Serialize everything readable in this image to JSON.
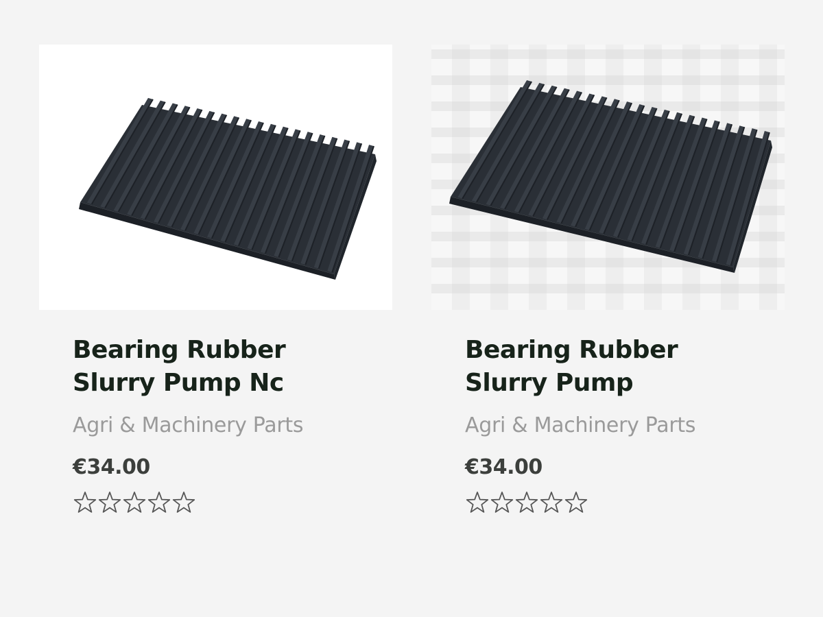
{
  "products": [
    {
      "image_alt": "Bearing Rubber Slurry Pump Nc",
      "title": "Bearing Rubber Slurry Pump Nc",
      "category": "Agri & Machinery Parts",
      "price": "€34.00",
      "rating": 0,
      "rating_max": 5
    },
    {
      "image_alt": "Bearing Rubber Slurry Pump",
      "title": "Bearing Rubber Slurry Pump",
      "category": "Agri & Machinery Parts",
      "price": "€34.00",
      "rating": 0,
      "rating_max": 5
    }
  ],
  "colors": {
    "background": "#f4f4f4",
    "title": "#17231a",
    "category": "#9a9a9a",
    "price": "#3c3f3c",
    "rubber": "#2b3037"
  },
  "icons": {
    "rating": "star-outline-icon"
  }
}
